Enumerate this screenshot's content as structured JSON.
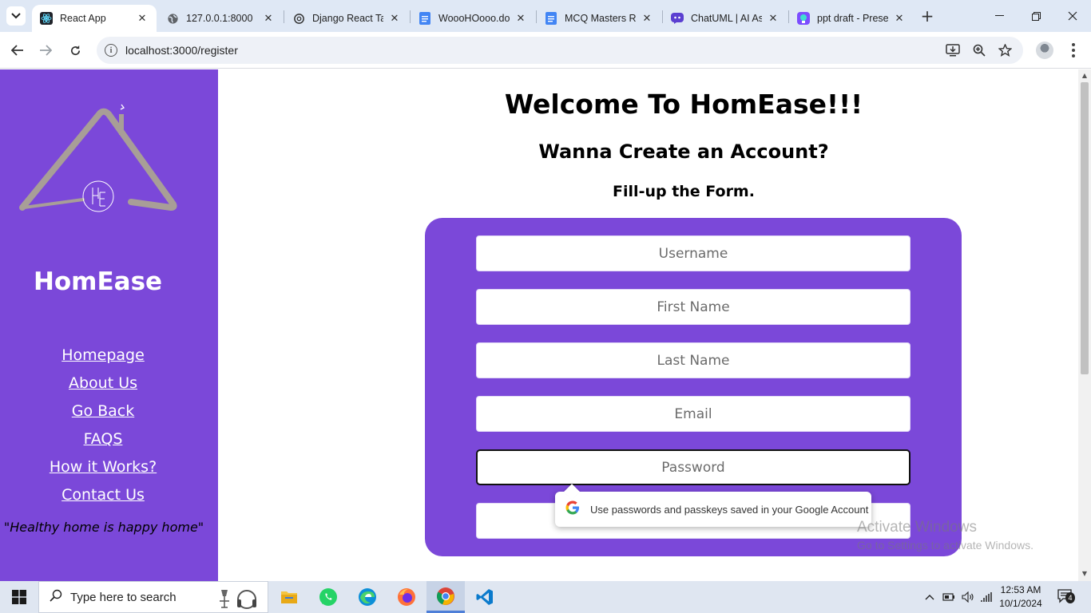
{
  "browser": {
    "tabs": [
      {
        "title": "React App",
        "icon": "react-icon",
        "active": true
      },
      {
        "title": "127.0.0.1:8000",
        "icon": "globe-icon",
        "active": false
      },
      {
        "title": "Django React Ta",
        "icon": "openai-icon",
        "active": false
      },
      {
        "title": "WoooHOooo.do",
        "icon": "google-docs-icon",
        "active": false
      },
      {
        "title": "MCQ Masters Re",
        "icon": "google-docs-icon",
        "active": false
      },
      {
        "title": "ChatUML | AI As",
        "icon": "chatuml-icon",
        "active": false
      },
      {
        "title": "ppt draft - Prese",
        "icon": "presentation-icon",
        "active": false
      }
    ],
    "url": "localhost:3000/register"
  },
  "sidebar": {
    "brand": "HomEase",
    "links": [
      "Homepage",
      "About Us",
      "Go Back",
      "FAQS",
      "How it Works?",
      "Contact Us"
    ],
    "tagline": "\"Healthy home is happy home\"",
    "color": "#7b48d9"
  },
  "main": {
    "title": "Welcome To HomEase!!!",
    "subtitle": "Wanna Create an Account?",
    "instruction": "Fill-up the Form.",
    "fields": [
      {
        "placeholder": "Username",
        "focused": false
      },
      {
        "placeholder": "First Name",
        "focused": false
      },
      {
        "placeholder": "Last Name",
        "focused": false
      },
      {
        "placeholder": "Email",
        "focused": false
      },
      {
        "placeholder": "Password",
        "focused": true
      },
      {
        "placeholder": "",
        "focused": false
      }
    ]
  },
  "password_popup": {
    "text": "Use passwords and passkeys saved in your Google Account"
  },
  "watermark": {
    "line1": "Activate Windows",
    "line2": "Go to Settings to activate Windows."
  },
  "taskbar": {
    "search_placeholder": "Type here to search",
    "time": "12:53 AM",
    "date": "10/1/2024",
    "notification_count": "4"
  }
}
